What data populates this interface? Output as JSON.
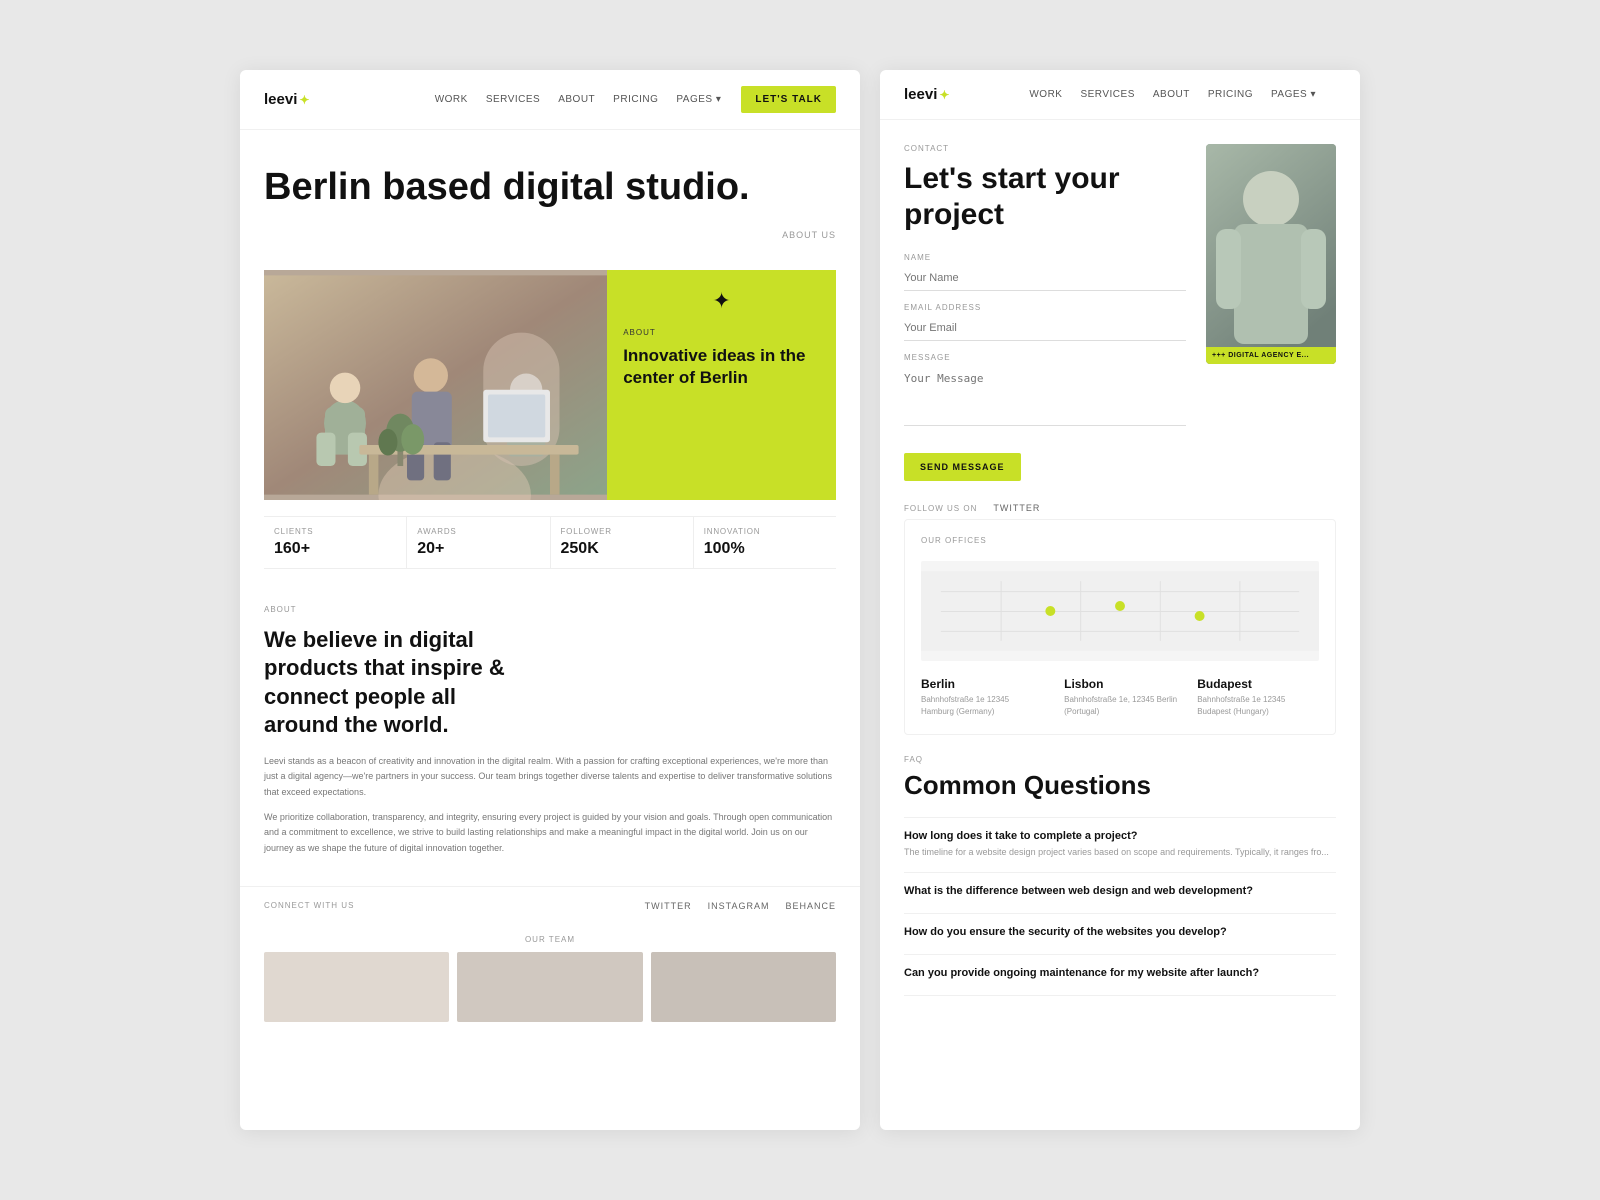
{
  "left_card": {
    "logo": "leevi",
    "nav_links": [
      "WORK",
      "SERVICES",
      "ABOUT",
      "PRICING",
      "PAGES ▾"
    ],
    "cta_button": "LET'S TALK",
    "hero_title": "Berlin based digital studio.",
    "about_us_label": "ABOUT US",
    "image_right": {
      "about_tag": "ABOUT",
      "text": "Innovative ideas in the center of Berlin"
    },
    "stats": [
      {
        "label": "CLIENTS",
        "value": "160+"
      },
      {
        "label": "AWARDS",
        "value": "20+"
      },
      {
        "label": "FOLLOWER",
        "value": "250K"
      },
      {
        "label": "INNOVATION",
        "value": "100%"
      }
    ],
    "about_section": {
      "tag": "ABOUT",
      "heading": "We believe in digital products that inspire & connect people all around the world.",
      "body1": "Leevi stands as a beacon of creativity and innovation in the digital realm. With a passion for crafting exceptional experiences, we're more than just a digital agency—we're partners in your success. Our team brings together diverse talents and expertise to deliver transformative solutions that exceed expectations.",
      "body2": "We prioritize collaboration, transparency, and integrity, ensuring every project is guided by your vision and goals. Through open communication and a commitment to excellence, we strive to build lasting relationships and make a meaningful impact in the digital world. Join us on our journey as we shape the future of digital innovation together."
    },
    "connect": {
      "label": "CONNECT WITH US",
      "links": [
        "TWITTER",
        "INSTAGRAM",
        "BEHANCE"
      ]
    },
    "our_team_label": "OUR TEAM"
  },
  "right_card": {
    "logo": "leevi",
    "nav_links": [
      "WORK",
      "SERVICES",
      "ABOUT",
      "PRICING",
      "PAGES ▾"
    ],
    "contact": {
      "tag": "CONTACT",
      "title": "Let's start your project",
      "fields": {
        "name_label": "NAME",
        "name_placeholder": "Your Name",
        "email_label": "EMAIL ADDRESS",
        "email_placeholder": "Your Email",
        "message_label": "MESSAGE",
        "message_placeholder": "Your Message"
      },
      "send_button": "SEND MESSAGE",
      "agency_badge": "+++ DIGITAL AGENCY E..."
    },
    "follow": {
      "label": "FOLLOW US ON",
      "platform": "TWITTER"
    },
    "offices": {
      "tag": "OUR OFFICES",
      "items": [
        {
          "city": "Berlin",
          "address": "Bahnhofstraße 1e\n12345 Hamburg (Germany)"
        },
        {
          "city": "Lisbon",
          "address": "Bahnhofstraße 1e,\n12345 Berlin (Portugal)"
        },
        {
          "city": "Budapest",
          "address": "Bahnhofstraße 1e\n12345 Budapest (Hungary)"
        }
      ]
    },
    "faq": {
      "tag": "FAQ",
      "title": "Common Questions",
      "items": [
        {
          "question": "How long does it take to complete a project?",
          "answer": "The timeline for a website design project varies based on scope and requirements. Typically, it ranges fro..."
        },
        {
          "question": "What is the difference between web design and web development?"
        },
        {
          "question": "How do you ensure the security of the websites you develop?"
        },
        {
          "question": "Can you provide ongoing maintenance for my website after launch?"
        }
      ]
    }
  }
}
